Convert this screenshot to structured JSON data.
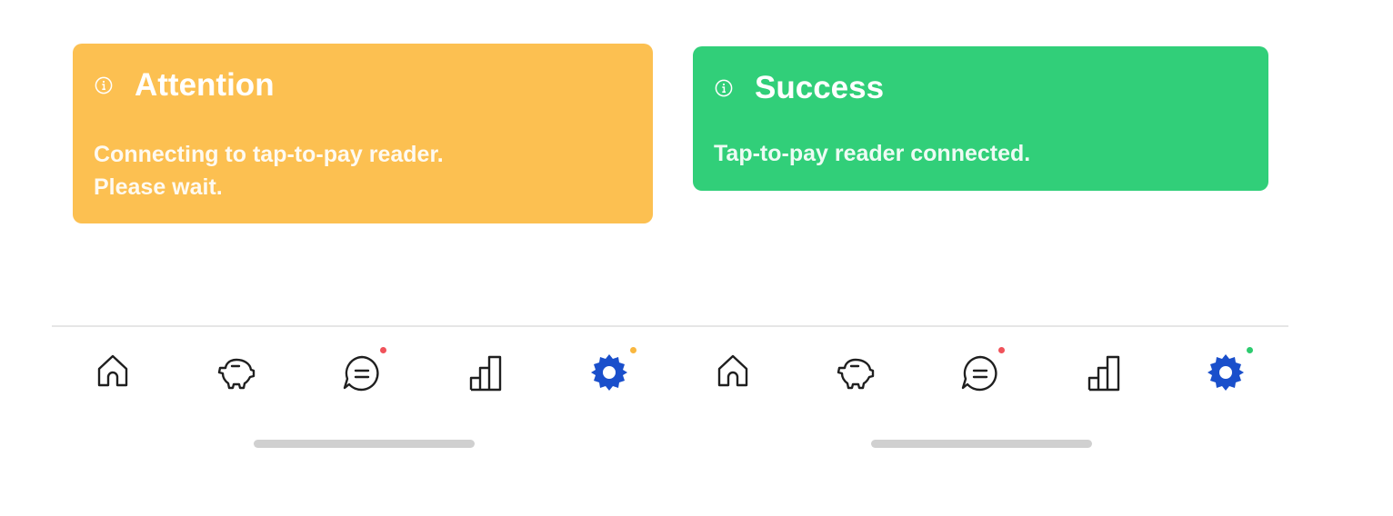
{
  "screens": [
    {
      "banner": {
        "title": "Attention",
        "message": "Connecting to tap-to-pay reader.\nPlease wait.",
        "color": "#FCC051",
        "icon": "info-circle-icon"
      },
      "nav": {
        "items": [
          "home-icon",
          "piggy-bank-icon",
          "chat-icon",
          "bar-chart-icon",
          "gear-icon"
        ],
        "active": "gear-icon",
        "active_color": "#1A4FCB",
        "chat_badge_color": "#F0525A",
        "gear_badge_color": "#F9B73F"
      }
    },
    {
      "banner": {
        "title": "Success",
        "message": "Tap-to-pay reader connected.",
        "color": "#31CF79",
        "icon": "info-circle-icon"
      },
      "nav": {
        "items": [
          "home-icon",
          "piggy-bank-icon",
          "chat-icon",
          "bar-chart-icon",
          "gear-icon"
        ],
        "active": "gear-icon",
        "active_color": "#1A4FCB",
        "chat_badge_color": "#F0525A",
        "gear_badge_color": "#2DCB6F"
      }
    }
  ]
}
